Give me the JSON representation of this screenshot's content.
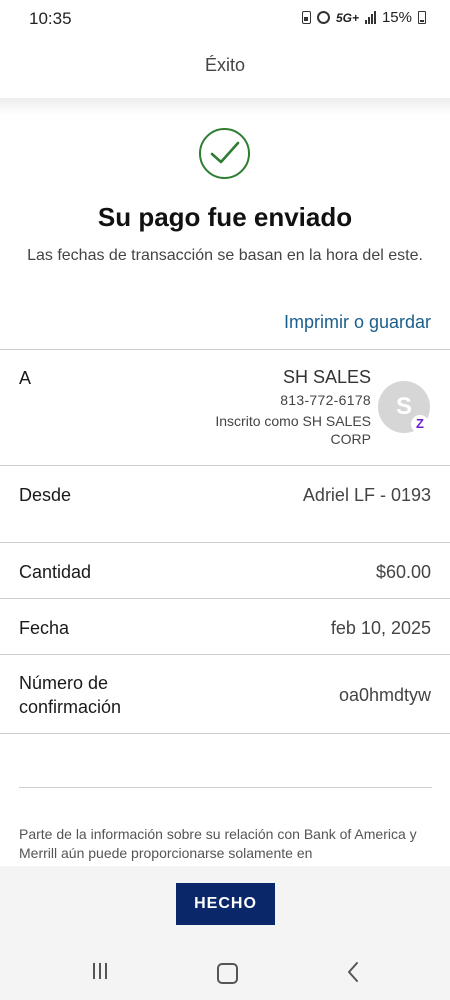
{
  "status_bar": {
    "time": "10:35",
    "network": "5G+",
    "battery": "15%"
  },
  "header": {
    "title": "Éxito"
  },
  "success": {
    "icon": "check-circle-icon",
    "title": "Su pago fue enviado",
    "subtitle": "Las fechas de transacción se basan en la hora del este.",
    "print_link": "Imprimir o guardar"
  },
  "details": {
    "to": {
      "label": "A",
      "name": "SH SALES",
      "phone": "813-772-6178",
      "enrolled": "Inscrito como SH SALES CORP",
      "avatar_initial": "S",
      "badge": "Z"
    },
    "from": {
      "label": "Desde",
      "value": "Adriel LF - 0193"
    },
    "amount": {
      "label": "Cantidad",
      "value": "$60.00"
    },
    "date": {
      "label": "Fecha",
      "value": "feb 10, 2025"
    },
    "confirmation": {
      "label": "Número de confirmación",
      "value": "oa0hmdtyw"
    }
  },
  "disclaimer": "Parte de la información sobre su relación con Bank of America y Merrill aún puede proporcionarse solamente en",
  "done_button": "HECHO",
  "nav": [
    "recents-icon",
    "home-icon",
    "back-icon"
  ],
  "colors": {
    "success_green": "#2e7d32",
    "link_blue": "#1a5f8c",
    "button_navy": "#0a2769",
    "zelle_purple": "#6d1ed4"
  }
}
